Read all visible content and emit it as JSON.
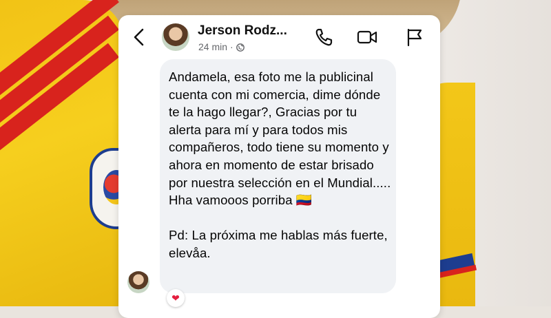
{
  "header": {
    "name": "Jerson Rodz...",
    "time": "24 min",
    "separator": "·"
  },
  "message": {
    "text": "Andamela, esa foto me la publicinal cuenta con mi comercia, dime dónde te la hago llegar?, Gracias por tu alerta para mí y para todos mis compañeros, todo tiene su momento y ahora en momento de estar brisado por nuestra selección en el Mundial..... Hha vamooos porriba 🇨🇴\n\nPd: La próxima me hablas más fuerte, elevåa."
  },
  "reaction": {
    "emoji": "❤",
    "icon": "heart-icon"
  },
  "icons": {
    "back": "chevron-left-icon",
    "phone": "phone-icon",
    "video": "video-camera-icon",
    "report": "flag-icon",
    "privacy": "globe-icon"
  },
  "colors": {
    "card": "#ffffff",
    "bubble": "#f0f2f5",
    "secondary_text": "#65676b",
    "reaction_heart": "#e41e3f"
  }
}
